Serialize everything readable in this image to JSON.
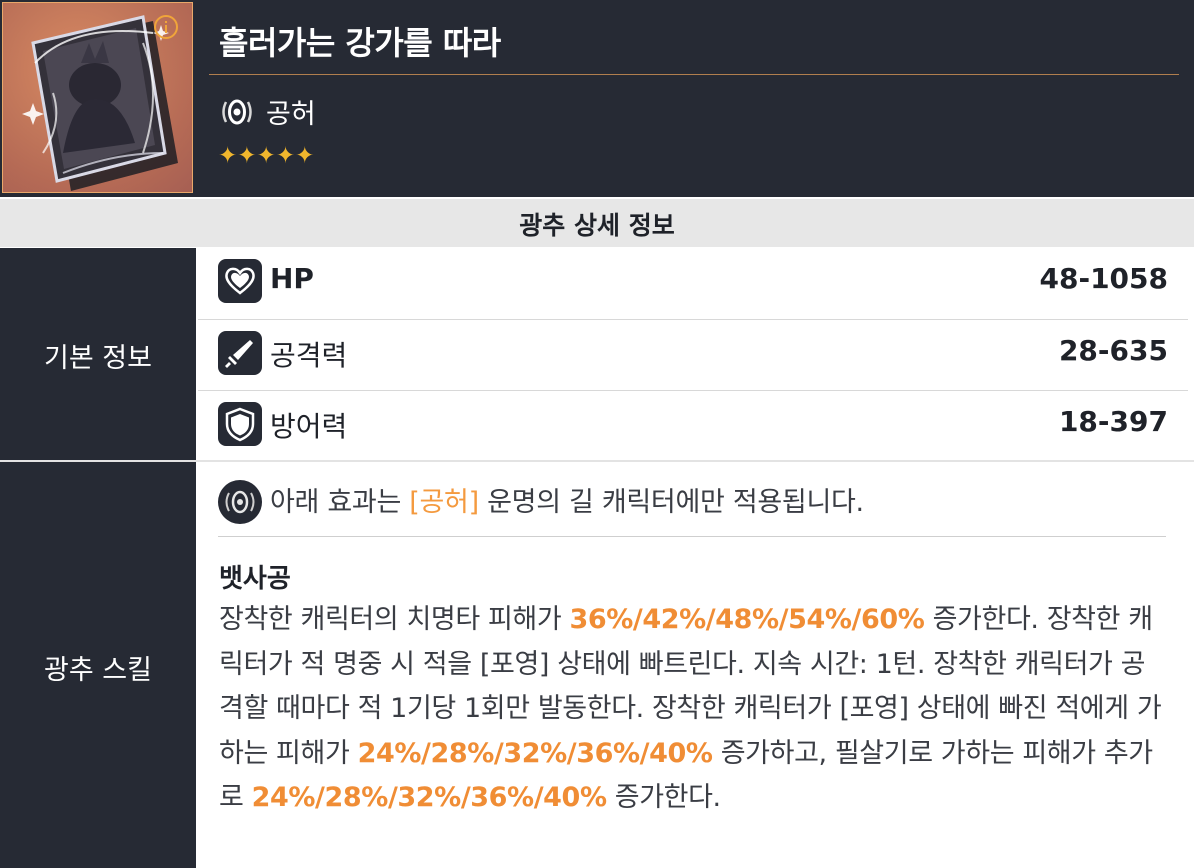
{
  "header": {
    "title": "흘러가는 강가를 따라",
    "path": "공허",
    "stars": "✦✦✦✦✦",
    "rarity": 5,
    "colors": {
      "bg": "#262a34",
      "accent": "#b07e4e",
      "star": "#f0b62d",
      "highlight": "#f08d35"
    }
  },
  "section_title": "광추 상세 정보",
  "basic": {
    "label": "기본 정보",
    "stats": [
      {
        "icon": "heart-icon",
        "name": "HP",
        "value": "48-1058"
      },
      {
        "icon": "sword-icon",
        "name": "공격력",
        "value": "28-635"
      },
      {
        "icon": "shield-icon",
        "name": "방어력",
        "value": "18-397"
      }
    ]
  },
  "skill": {
    "label": "광추 스킬",
    "note_before": "아래 효과는 ",
    "note_path": "[공허]",
    "note_after": " 운명의 길 캐릭터에만 적용됩니다.",
    "name": "뱃사공",
    "text": [
      "장착한 캐릭터의 치명타 피해가 ",
      "36%/42%/48%/54%/60%",
      " 증가한다. 장착한 캐릭터가 적 명중 시 적을 [포영] 상태에 빠트린다. 지속 시간: 1턴. 장착한 캐릭터가 공격할 때마다 적 1기당 1회만 발동한다. 장착한 캐릭터가 [포영] 상태에 빠진 적에게 가하는 피해가 ",
      "24%/28%/32%/36%/40%",
      " 증가하고, 필살기로 가하는 피해가 추가로 ",
      "24%/28%/32%/36%/40%",
      " 증가한다."
    ]
  }
}
